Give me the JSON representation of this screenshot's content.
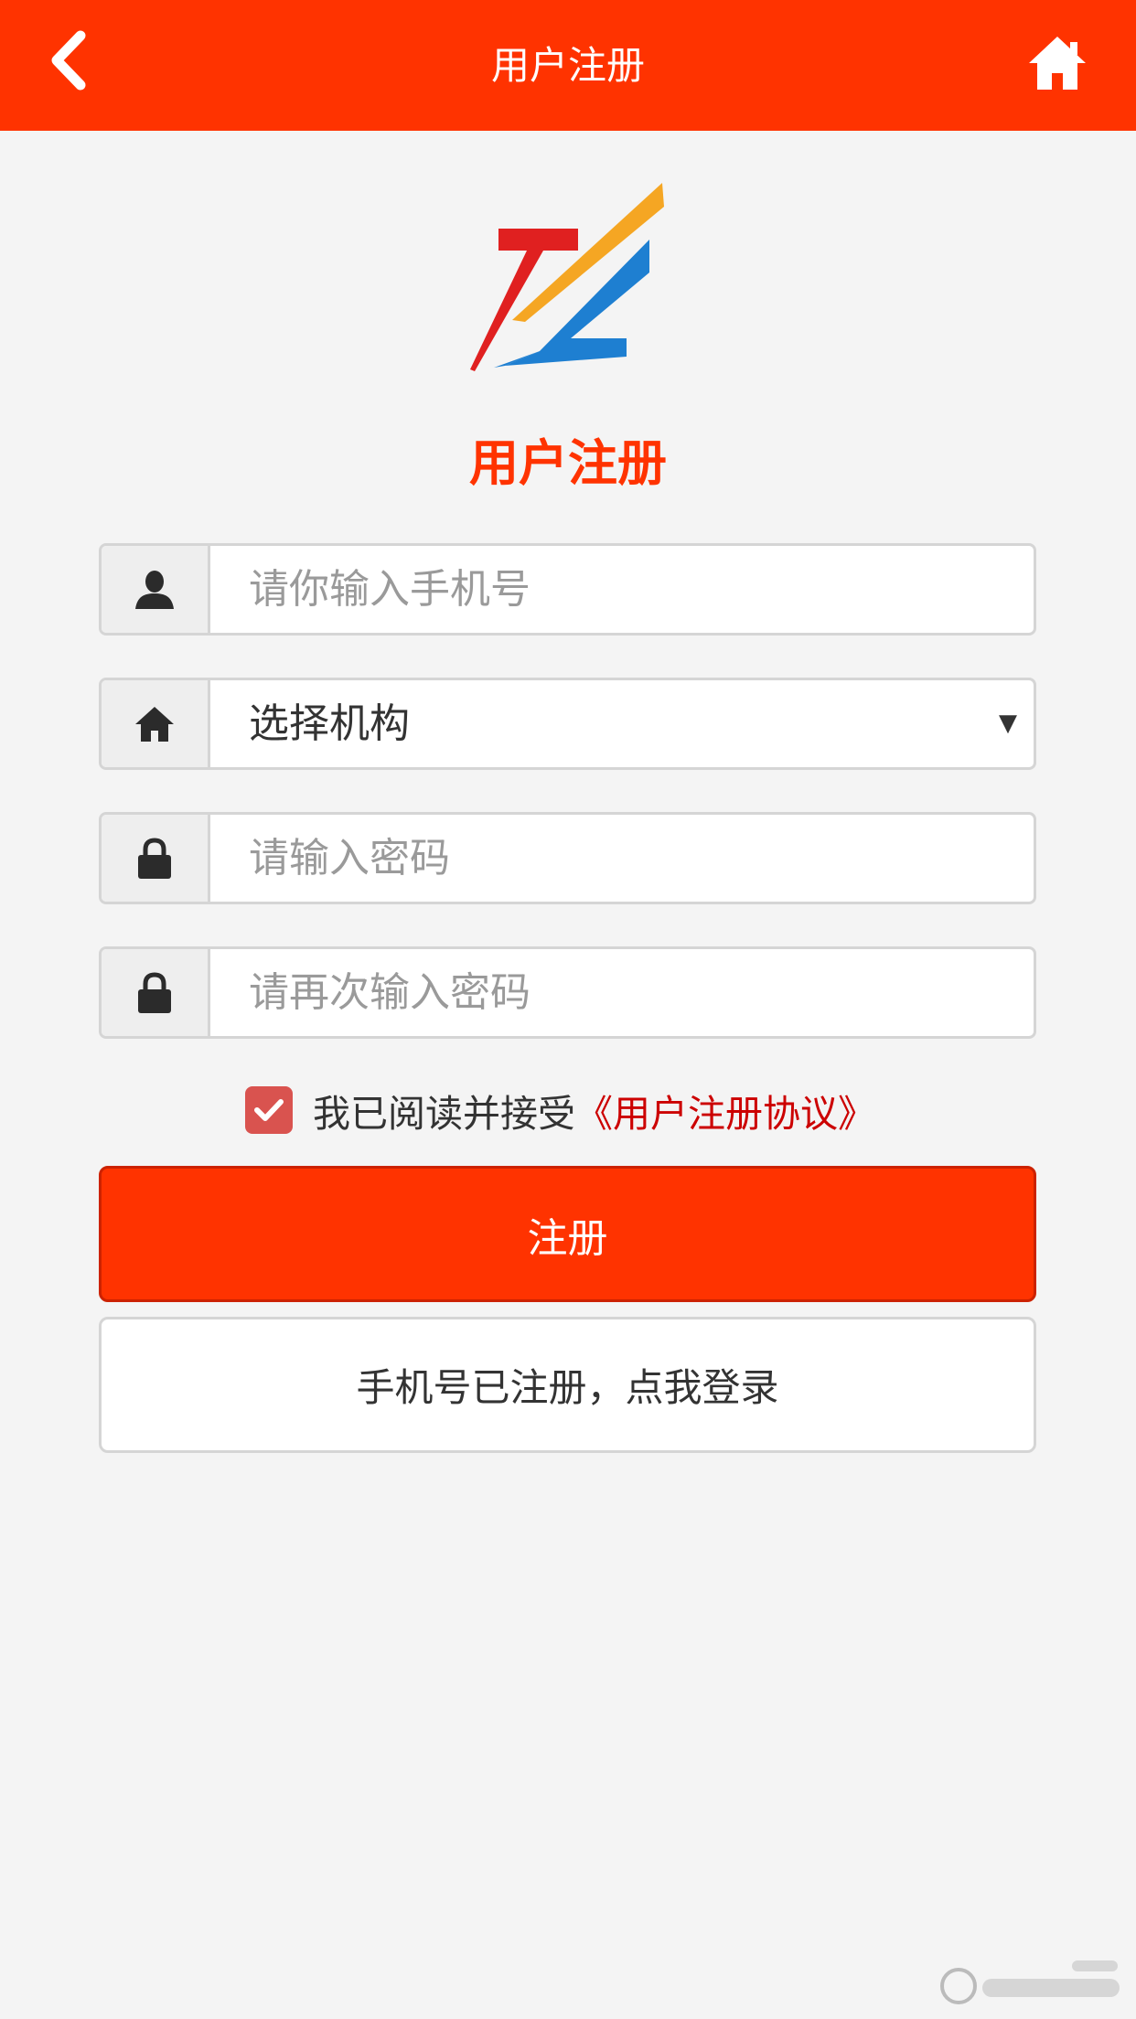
{
  "header": {
    "title": "用户注册",
    "back_icon": "chevron-left-icon",
    "home_icon": "home-icon"
  },
  "brand": {
    "logo": "z-logo",
    "colors": {
      "red": "#e02020",
      "yellow": "#f5a623",
      "blue": "#1e7fd1"
    }
  },
  "page_title": "用户注册",
  "form": {
    "phone": {
      "placeholder": "请你输入手机号",
      "icon": "user-icon"
    },
    "institution": {
      "value": "选择机构",
      "arrow": "▼",
      "icon": "home-icon"
    },
    "password": {
      "placeholder": "请输入密码",
      "icon": "lock-icon"
    },
    "password_confirm": {
      "placeholder": "请再次输入密码",
      "icon": "lock-icon"
    }
  },
  "agreement": {
    "checked": true,
    "text": "我已阅读并接受",
    "link": "《用户注册协议》"
  },
  "buttons": {
    "register": "注册",
    "login": "手机号已注册，点我登录"
  },
  "theme": {
    "primary": "#ff3300",
    "checkbox": "#d9534f",
    "link": "#cc0000",
    "background": "#f4f4f4"
  }
}
